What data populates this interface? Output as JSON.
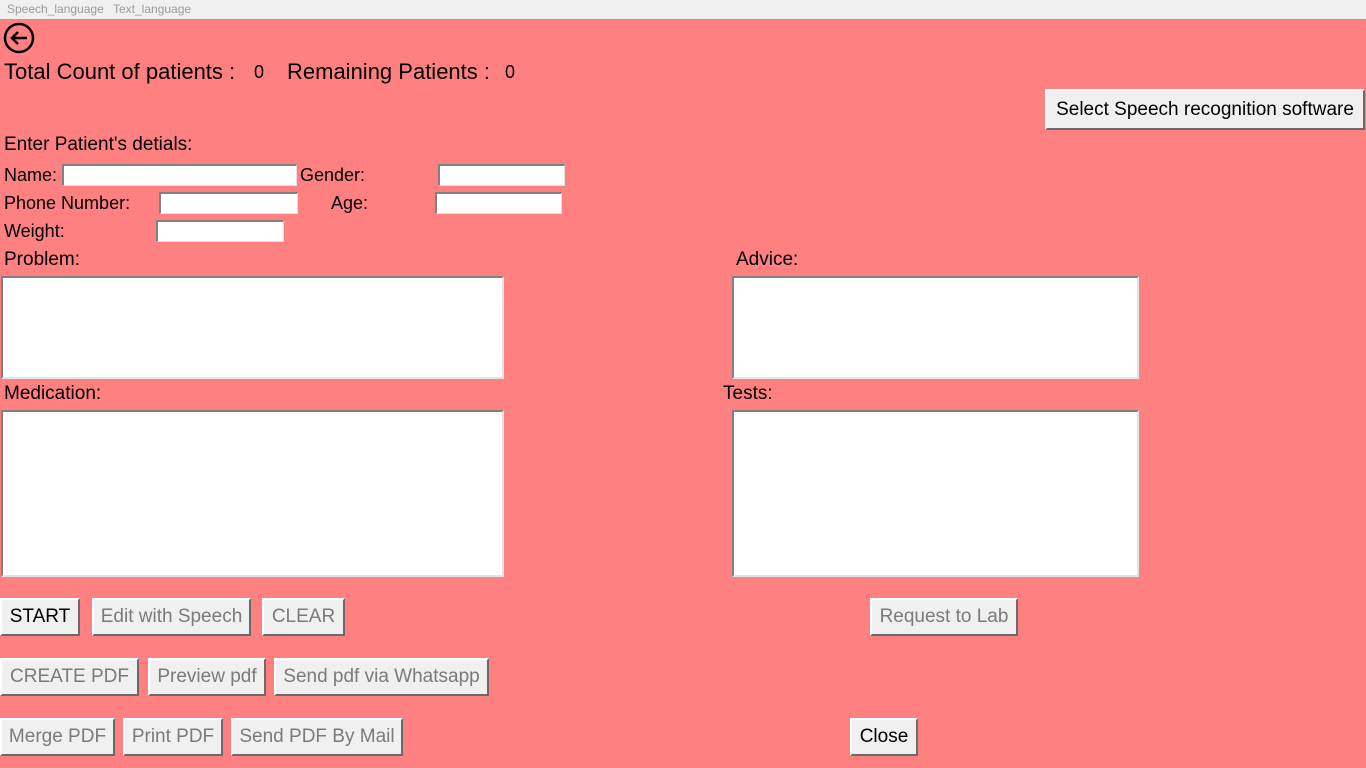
{
  "menubar": {
    "items": [
      "Speech_language",
      "Text_language"
    ]
  },
  "header": {
    "total_label": "Total Count of patients :",
    "total_value": "0",
    "remaining_label": "Remaining Patients :",
    "remaining_value": "0",
    "select_software_label": "Select Speech recognition software"
  },
  "form": {
    "section_title": "Enter Patient's detials:",
    "name_label": "Name:",
    "name_value": "",
    "gender_label": "Gender:",
    "gender_value": "",
    "phone_label": "Phone Number:",
    "phone_value": "",
    "age_label": "Age:",
    "age_value": "",
    "weight_label": "Weight:",
    "weight_value": "",
    "problem_label": "Problem:",
    "advice_label": "Advice:",
    "medication_label": "Medication:",
    "tests_label": "Tests:"
  },
  "buttons": {
    "start": "START",
    "edit_speech": "Edit with Speech",
    "clear": "CLEAR",
    "request_lab": "Request to Lab",
    "create_pdf": "CREATE PDF",
    "preview_pdf": "Preview pdf",
    "send_whatsapp": "Send pdf via Whatsapp",
    "merge_pdf": "Merge PDF",
    "print_pdf": "Print PDF",
    "send_mail": "Send PDF By Mail",
    "close": "Close"
  },
  "icons": {
    "back": "back-arrow-icon"
  },
  "colors": {
    "background": "#ff8080",
    "button": "#f0f0f0",
    "disabled_text": "#7a7a7a"
  }
}
